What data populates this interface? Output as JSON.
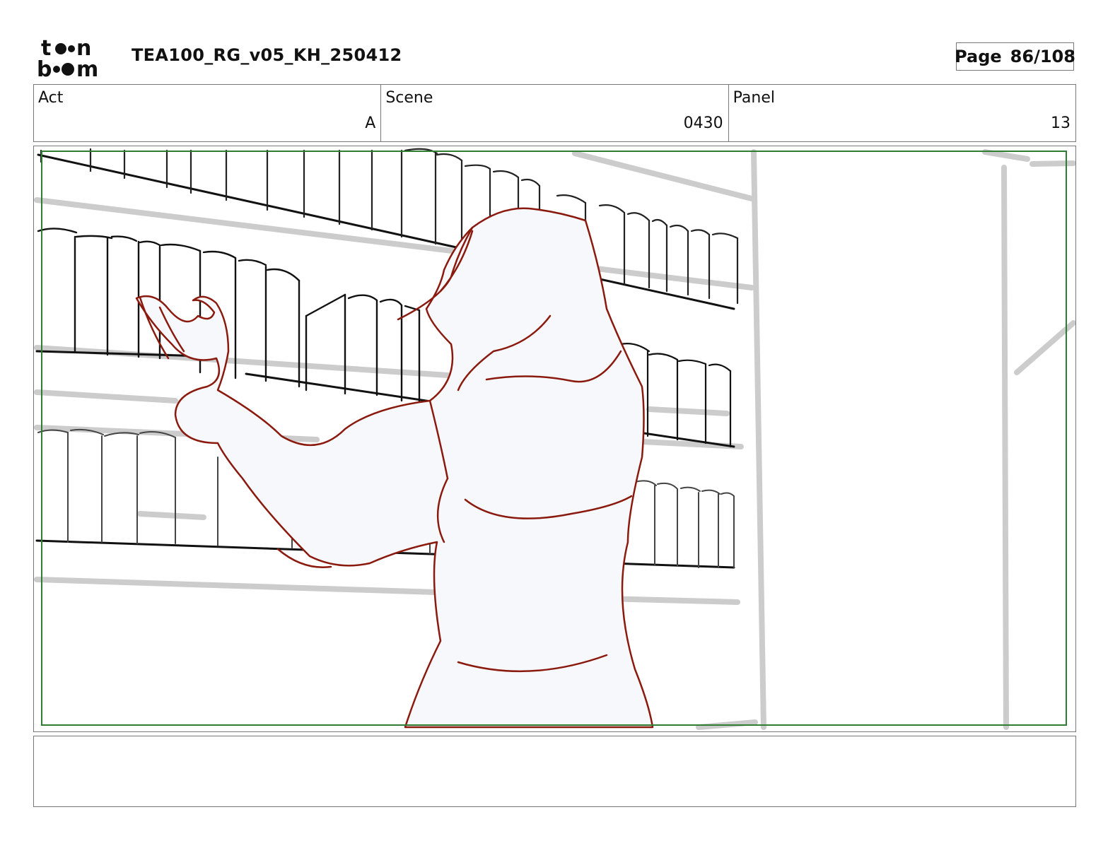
{
  "header": {
    "logo_text": "toon boom",
    "title": "TEA100_RG_v05_KH_250412",
    "page_label": "Page",
    "page_number": "86/108"
  },
  "info": {
    "act_label": "Act",
    "act_value": "A",
    "scene_label": "Scene",
    "scene_value": "0430",
    "panel_label": "Panel",
    "panel_value": "13"
  },
  "colors": {
    "safe_frame": "#2e7d32",
    "figure_line": "#8b1a0e",
    "figure_fill": "#f7f8fc",
    "shelf_gray": "#cccccc",
    "ink": "#111111"
  },
  "notes": {
    "text": ""
  }
}
